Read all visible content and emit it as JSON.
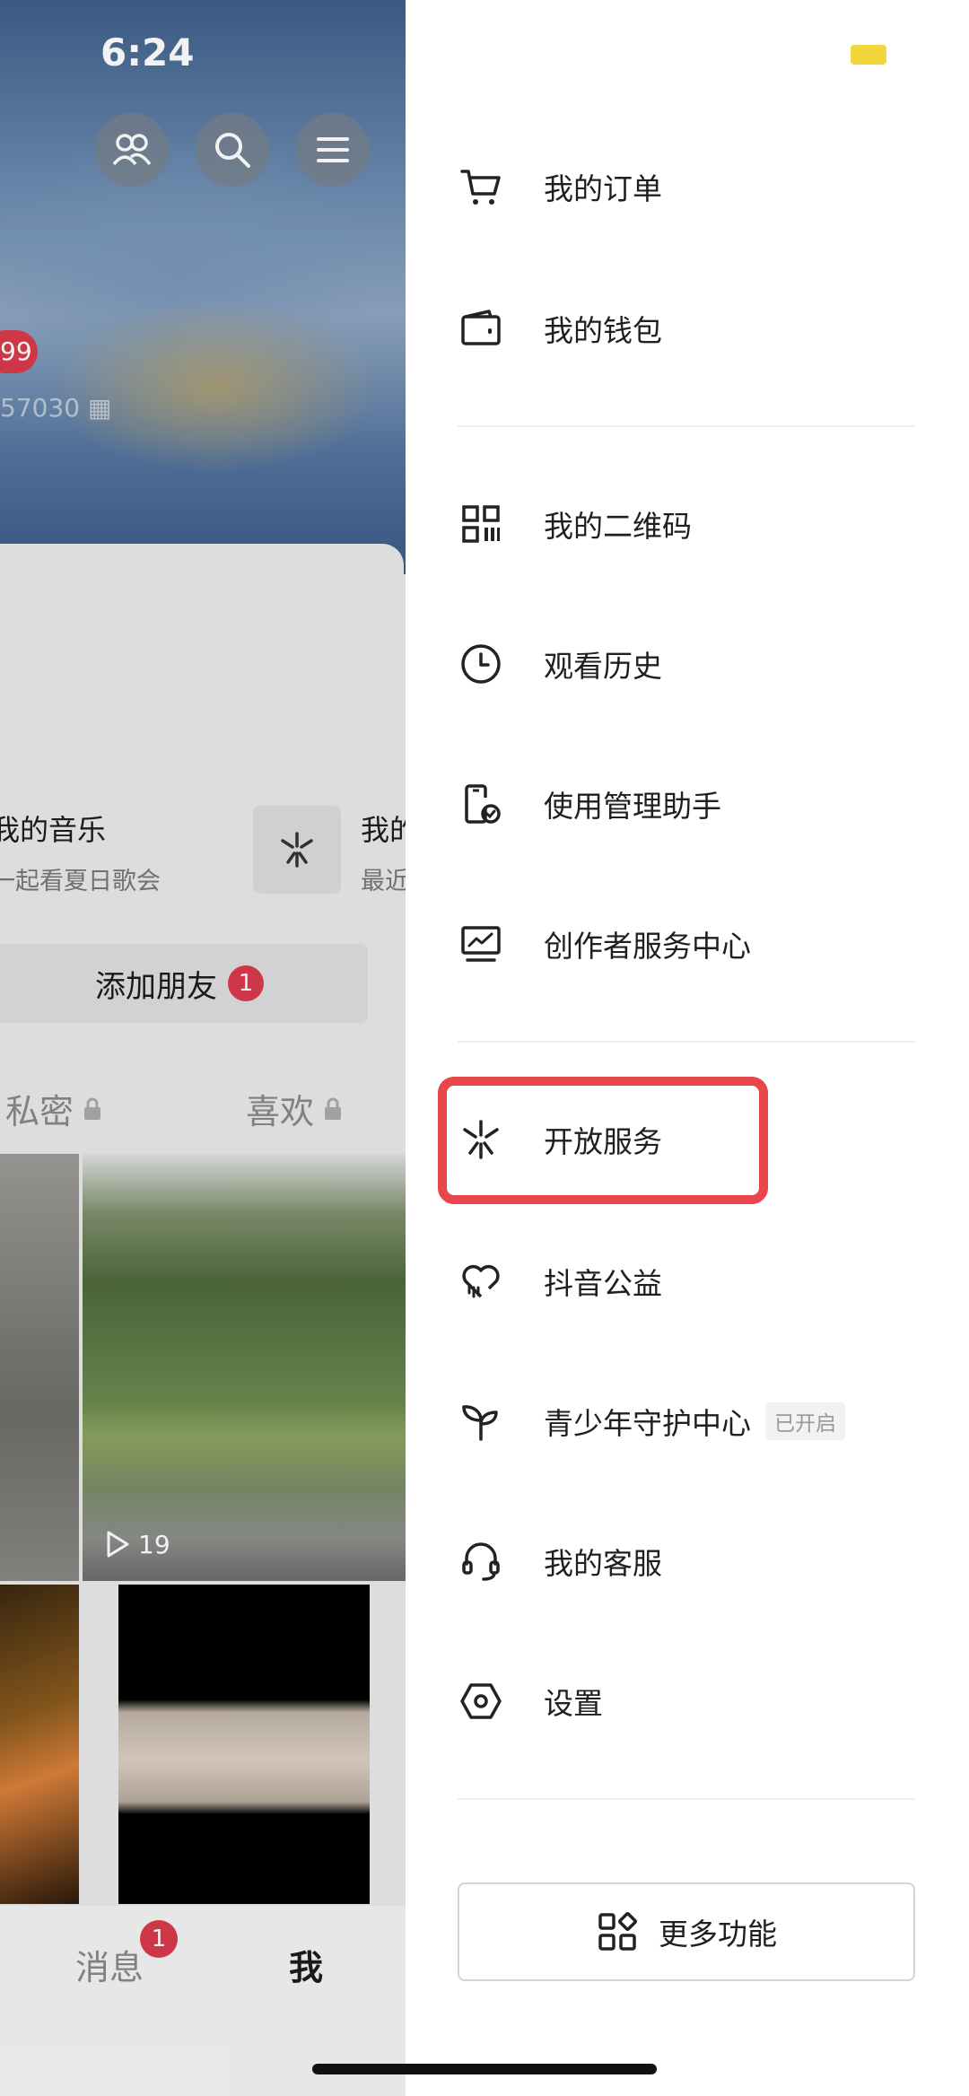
{
  "status_bar": {
    "time": "6:24"
  },
  "profile": {
    "badge_count": "99",
    "id_text": "57030",
    "music_title": "我的音乐",
    "music_subtitle": "一起看夏日歌会",
    "second_title": "我的",
    "second_subtitle": "最近",
    "add_friend_label": "添加朋友",
    "add_friend_badge": "1",
    "tabs": [
      "私密",
      "喜欢"
    ],
    "play_count": "19",
    "bottom_nav": {
      "messages": "消息",
      "messages_badge": "1",
      "me": "我"
    }
  },
  "drawer": {
    "items": [
      {
        "label": "我的订单",
        "icon": "cart-icon"
      },
      {
        "label": "我的钱包",
        "icon": "wallet-icon"
      },
      {
        "label": "我的二维码",
        "icon": "qrcode-icon"
      },
      {
        "label": "观看历史",
        "icon": "clock-icon"
      },
      {
        "label": "使用管理助手",
        "icon": "phone-check-icon"
      },
      {
        "label": "创作者服务中心",
        "icon": "chart-monitor-icon"
      },
      {
        "label": "开放服务",
        "icon": "sparkle-icon"
      },
      {
        "label": "抖音公益",
        "icon": "heart-hand-icon"
      },
      {
        "label": "青少年守护中心",
        "icon": "sprout-icon",
        "tag": "已开启"
      },
      {
        "label": "我的客服",
        "icon": "headset-icon"
      },
      {
        "label": "设置",
        "icon": "hexagon-gear-icon"
      }
    ],
    "more_button": "更多功能"
  },
  "colors": {
    "highlight": "#e8464b",
    "badge": "#d93a4c",
    "battery": "#f3d53c"
  }
}
